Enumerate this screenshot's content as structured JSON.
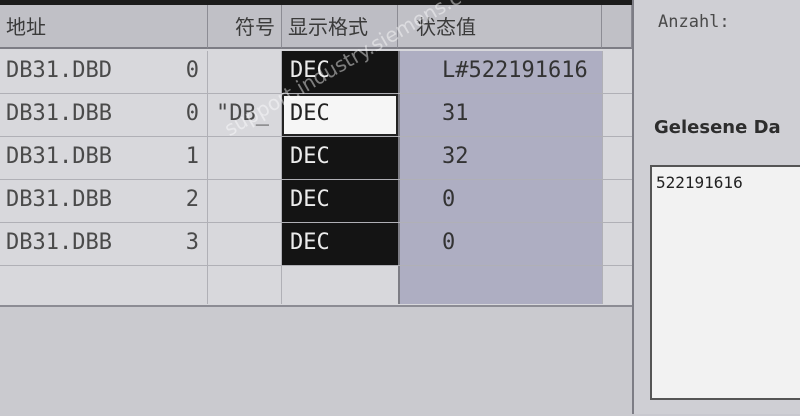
{
  "table": {
    "headers": {
      "address": "地址",
      "symbol": "符号",
      "format": "显示格式",
      "status": "状态值"
    },
    "rows": [
      {
        "address": "DB31.DBD",
        "index": "0",
        "symbol": "",
        "format": "DEC",
        "value": "L#522191616"
      },
      {
        "address": "DB31.DBB",
        "index": "0",
        "symbol": "\"DB_",
        "format": "DEC",
        "value": "31"
      },
      {
        "address": "DB31.DBB",
        "index": "1",
        "symbol": "",
        "format": "DEC",
        "value": "32"
      },
      {
        "address": "DB31.DBB",
        "index": "2",
        "symbol": "",
        "format": "DEC",
        "value": "0"
      },
      {
        "address": "DB31.DBB",
        "index": "3",
        "symbol": "",
        "format": "DEC",
        "value": "0"
      }
    ]
  },
  "panel": {
    "count_label": "Anzahl:",
    "read_label": "Gelesene Da",
    "output_value": "522191616"
  },
  "watermark": "support.industry.siemens.com/cs"
}
